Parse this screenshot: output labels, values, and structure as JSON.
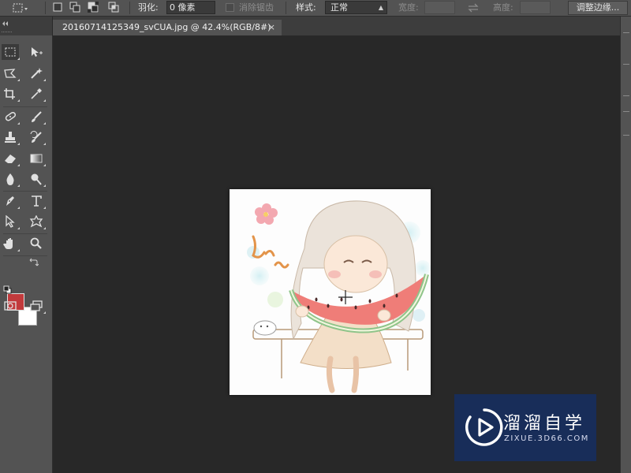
{
  "options_bar": {
    "feather_label": "羽化:",
    "feather_value": "0 像素",
    "antialias_label": "消除锯齿",
    "style_label": "样式:",
    "style_value": "正常",
    "width_label": "宽度:",
    "height_label": "高度:",
    "refine_edge_button": "调整边缘..."
  },
  "document_tab": {
    "title": "20160714125349_svCUA.jpg @ 42.4%(RGB/8#)",
    "close": "×"
  },
  "colors": {
    "foreground": "#c23a3c",
    "background": "#ffffff"
  },
  "toolbar": {
    "tools": [
      "rectangular-marquee-tool",
      "move-tool",
      "polygonal-lasso-tool",
      "magic-wand-tool",
      "crop-tool",
      "eyedropper-tool",
      "spot-healing-brush-tool",
      "brush-tool",
      "clone-stamp-tool",
      "history-brush-tool",
      "eraser-tool",
      "gradient-tool",
      "blur-tool",
      "dodge-tool",
      "pen-tool",
      "type-tool",
      "path-selection-tool",
      "custom-shape-tool",
      "hand-tool",
      "zoom-tool"
    ]
  },
  "watermark": {
    "title": "溜溜自学",
    "url": "ZIXUE.3D66.COM"
  }
}
